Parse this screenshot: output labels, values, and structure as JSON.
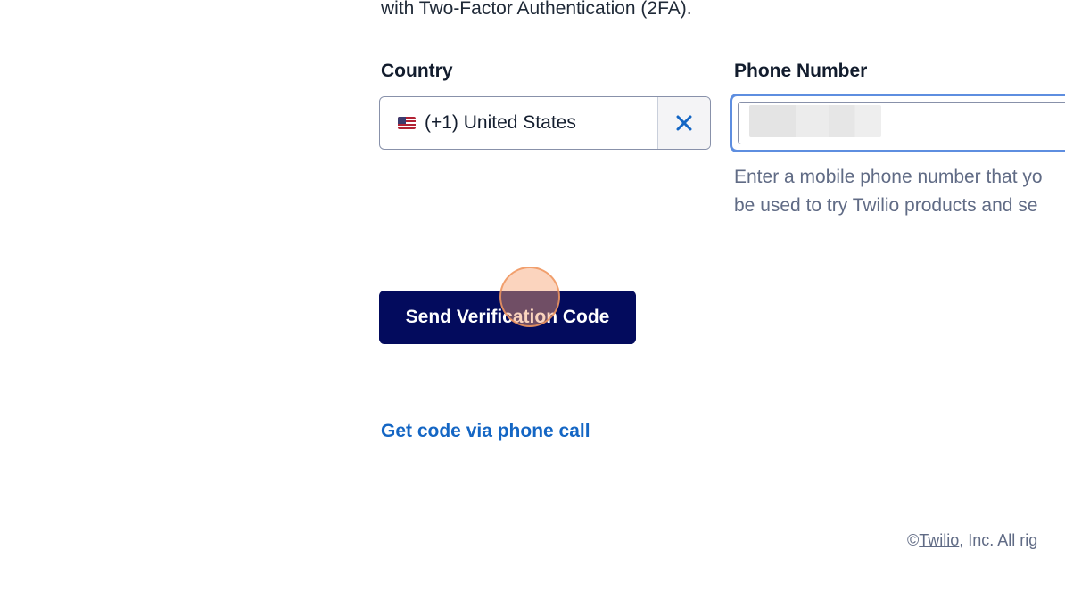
{
  "intro": {
    "text": "with Two-Factor Authentication (2FA)."
  },
  "country": {
    "label": "Country",
    "value": "(+1) United States",
    "flag_icon": "us-flag-icon",
    "clear_icon": "close-icon"
  },
  "phone": {
    "label": "Phone Number",
    "value": "",
    "helper_line1": "Enter a mobile phone number that yo",
    "helper_line2": "be used to try Twilio products and se"
  },
  "actions": {
    "send_label": "Send Verification Code",
    "phone_call_link": "Get code via phone call"
  },
  "footer": {
    "copyright_symbol": "©",
    "company_link": "Twilio",
    "rest": ", Inc. All rig"
  },
  "colors": {
    "primary_button": "#030b5d",
    "link": "#1466c4",
    "focus_ring": "#5e8ee0",
    "helper_text": "#606b85"
  }
}
